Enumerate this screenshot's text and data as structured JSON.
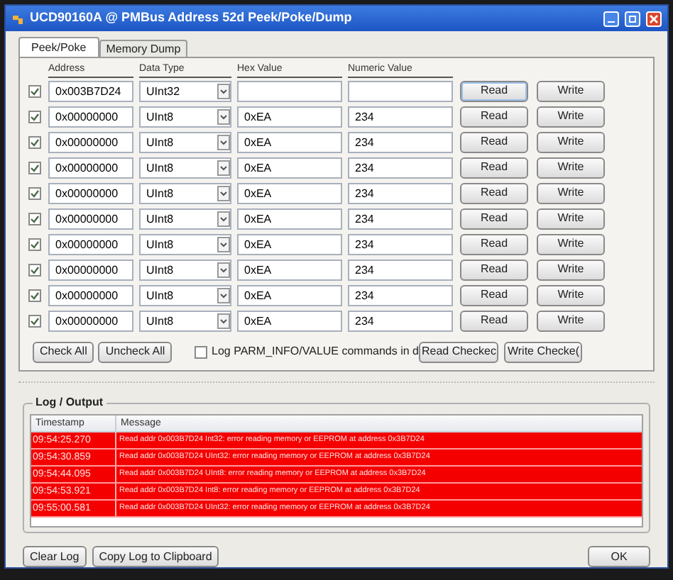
{
  "window": {
    "title": "UCD90160A @ PMBus Address 52d Peek/Poke/Dump"
  },
  "tabs": [
    {
      "label": "Peek/Poke",
      "selected": true
    },
    {
      "label": "Memory Dump",
      "selected": false
    }
  ],
  "columns": [
    "Address",
    "Data Type",
    "Hex Value",
    "Numeric Value"
  ],
  "rows": [
    {
      "checked": true,
      "address": "0x003B7D24",
      "data_type": "UInt32",
      "hex_value": "",
      "numeric_value": "",
      "read": "Read",
      "write": "Write",
      "focused": true
    },
    {
      "checked": true,
      "address": "0x00000000",
      "data_type": "UInt8",
      "hex_value": "0xEA",
      "numeric_value": "234",
      "read": "Read",
      "write": "Write",
      "focused": false
    },
    {
      "checked": true,
      "address": "0x00000000",
      "data_type": "UInt8",
      "hex_value": "0xEA",
      "numeric_value": "234",
      "read": "Read",
      "write": "Write",
      "focused": false
    },
    {
      "checked": true,
      "address": "0x00000000",
      "data_type": "UInt8",
      "hex_value": "0xEA",
      "numeric_value": "234",
      "read": "Read",
      "write": "Write",
      "focused": false
    },
    {
      "checked": true,
      "address": "0x00000000",
      "data_type": "UInt8",
      "hex_value": "0xEA",
      "numeric_value": "234",
      "read": "Read",
      "write": "Write",
      "focused": false
    },
    {
      "checked": true,
      "address": "0x00000000",
      "data_type": "UInt8",
      "hex_value": "0xEA",
      "numeric_value": "234",
      "read": "Read",
      "write": "Write",
      "focused": false
    },
    {
      "checked": true,
      "address": "0x00000000",
      "data_type": "UInt8",
      "hex_value": "0xEA",
      "numeric_value": "234",
      "read": "Read",
      "write": "Write",
      "focused": false
    },
    {
      "checked": true,
      "address": "0x00000000",
      "data_type": "UInt8",
      "hex_value": "0xEA",
      "numeric_value": "234",
      "read": "Read",
      "write": "Write",
      "focused": false
    },
    {
      "checked": true,
      "address": "0x00000000",
      "data_type": "UInt8",
      "hex_value": "0xEA",
      "numeric_value": "234",
      "read": "Read",
      "write": "Write",
      "focused": false
    },
    {
      "checked": true,
      "address": "0x00000000",
      "data_type": "UInt8",
      "hex_value": "0xEA",
      "numeric_value": "234",
      "read": "Read",
      "write": "Write",
      "focused": false
    }
  ],
  "check_all": "Check All",
  "uncheck_all": "Uncheck All",
  "log_option": {
    "label": "Log PARM_INFO/VALUE commands in d",
    "checked": false
  },
  "read_checked": "Read Checkec",
  "write_checked": "Write Checke(",
  "log": {
    "title": "Log / Output",
    "columns": [
      "Timestamp",
      "Message"
    ],
    "entries": [
      {
        "kind": "error",
        "timestamp": "09:54:25.270",
        "message": "Read addr 0x003B7D24 Int32: error reading memory or EEPROM at address 0x3B7D24"
      },
      {
        "kind": "error",
        "timestamp": "09:54:30.859",
        "message": "Read addr 0x003B7D24 UInt32: error reading memory or EEPROM at address 0x3B7D24"
      },
      {
        "kind": "error",
        "timestamp": "09:54:44.095",
        "message": "Read addr 0x003B7D24 UInt8: error reading memory or EEPROM at address 0x3B7D24"
      },
      {
        "kind": "error",
        "timestamp": "09:54:53.921",
        "message": "Read addr 0x003B7D24 Int8: error reading memory or EEPROM at address 0x3B7D24"
      },
      {
        "kind": "error",
        "timestamp": "09:55:00.581",
        "message": "Read addr 0x003B7D24 UInt32: error reading memory or EEPROM at address 0x3B7D24"
      }
    ]
  },
  "buttons": {
    "clear": "Clear Log",
    "copy": "Copy Log to Clipboard",
    "ok": "OK"
  }
}
